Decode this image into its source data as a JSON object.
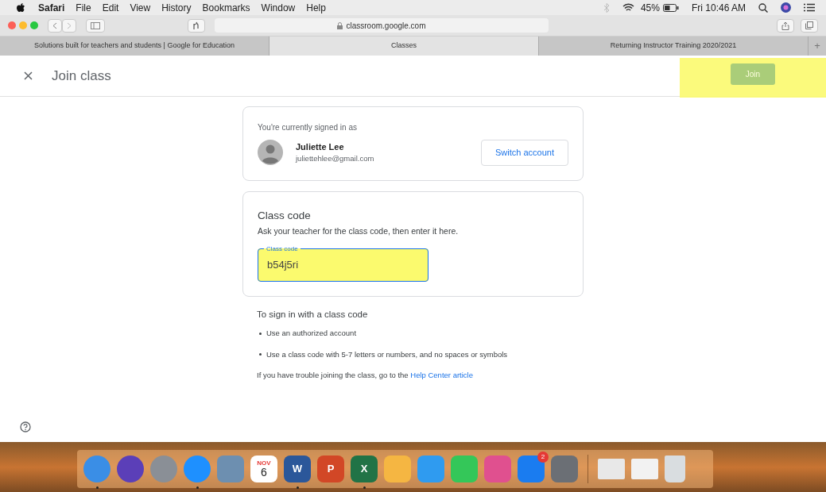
{
  "menu_bar": {
    "app": "Safari",
    "menus": [
      "File",
      "Edit",
      "View",
      "History",
      "Bookmarks",
      "Window",
      "Help"
    ],
    "battery": "45%",
    "clock": "Fri 10:46 AM"
  },
  "toolbar": {
    "address": "classroom.google.com"
  },
  "tabs": [
    {
      "label": "Solutions built for teachers and students | Google for Education",
      "selected": false
    },
    {
      "label": "Classes",
      "selected": true
    },
    {
      "label": "Returning Instructor Training 2020/2021",
      "selected": false
    }
  ],
  "new_tab": "+",
  "header": {
    "title": "Join class",
    "join_button": {
      "label": "Join",
      "disabled": true,
      "highlighted": true
    }
  },
  "account_card": {
    "caption": "You're currently signed in as",
    "name": "Juliette Lee",
    "email": "juliettehlee@gmail.com",
    "switch_button": "Switch account"
  },
  "code_card": {
    "title": "Class code",
    "hint": "Ask your teacher for the class code, then enter it here.",
    "field": {
      "label": "Class code",
      "value": "b54j5ri",
      "highlighted": true
    }
  },
  "instructions": {
    "title": "To sign in with a class code",
    "bullets": [
      "Use an authorized account",
      "Use a class code with 5-7 letters or numbers, and no spaces or symbols"
    ],
    "footer": "If you have trouble joining the class, go to the",
    "link": "Help Center article"
  },
  "dock": [
    {
      "kind": "app",
      "color": "#3a8ee6",
      "running": true
    },
    {
      "kind": "app",
      "color": "#5b3fb8",
      "running": false
    },
    {
      "kind": "app",
      "color": "#8a8f96",
      "running": false
    },
    {
      "kind": "app",
      "color": "#1e90ff",
      "running": true
    },
    {
      "kind": "app",
      "color": "#6d8fb0",
      "running": false
    },
    {
      "kind": "calendar",
      "month": "NOV",
      "day": "6",
      "running": false
    },
    {
      "kind": "letter",
      "letter": "W",
      "color": "#2b579a",
      "running": true
    },
    {
      "kind": "letter",
      "letter": "P",
      "color": "#d24726",
      "running": false
    },
    {
      "kind": "letter",
      "letter": "X",
      "color": "#217346",
      "running": true
    },
    {
      "kind": "app",
      "color": "#f5b642",
      "running": false
    },
    {
      "kind": "app",
      "color": "#2f9bf0",
      "running": false
    },
    {
      "kind": "app",
      "color": "#34c759",
      "running": false
    },
    {
      "kind": "app",
      "color": "#e0508f",
      "running": false
    },
    {
      "kind": "app",
      "color": "#1a7cf0",
      "badge": "2",
      "running": false
    },
    {
      "kind": "app",
      "color": "#6b6f75",
      "running": false
    },
    {
      "kind": "separator"
    },
    {
      "kind": "document",
      "color": "#e8e8e8",
      "running": false
    },
    {
      "kind": "document",
      "color": "#f2f2f2",
      "running": false
    },
    {
      "kind": "trash",
      "color": "#d9dde0",
      "running": false
    }
  ]
}
